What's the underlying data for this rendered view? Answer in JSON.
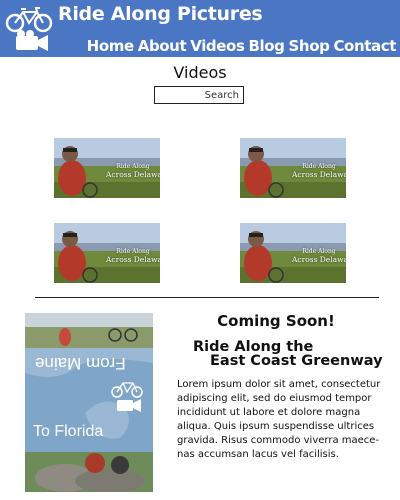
{
  "header": {
    "site_title": "Ride Along Pictures",
    "nav": [
      "Home",
      "About",
      "Videos",
      "Blog",
      "Shop",
      "Contact"
    ],
    "background_color": "#4a76c4"
  },
  "videos": {
    "heading": "Videos",
    "search_placeholder": "Search",
    "items": [
      {
        "caption_line1": "Ride Along",
        "caption_line2": "Across Delaware"
      },
      {
        "caption_line1": "Ride Along",
        "caption_line2": "Across Delaware"
      },
      {
        "caption_line1": "Ride Along",
        "caption_line2": "Across Delaware"
      },
      {
        "caption_line1": "Ride Along",
        "caption_line2": "Across Delaware"
      }
    ]
  },
  "coming_soon": {
    "heading": "Coming Soon!",
    "subtitle_line1": "Ride Along the",
    "subtitle_line2": "East Coast Greenway",
    "poster_text_top": "From Maine",
    "poster_text_bottom": "To Florida",
    "body": "Lorem ipsum dolor sit amet, consectetur adipiscing elit, sed do eiusmod tempor incididunt ut labore et dolore magna aliqua. Quis ipsum suspendisse ultrices gravida. Risus commodo viverra maece-nas accumsan lacus vel facilisis."
  }
}
